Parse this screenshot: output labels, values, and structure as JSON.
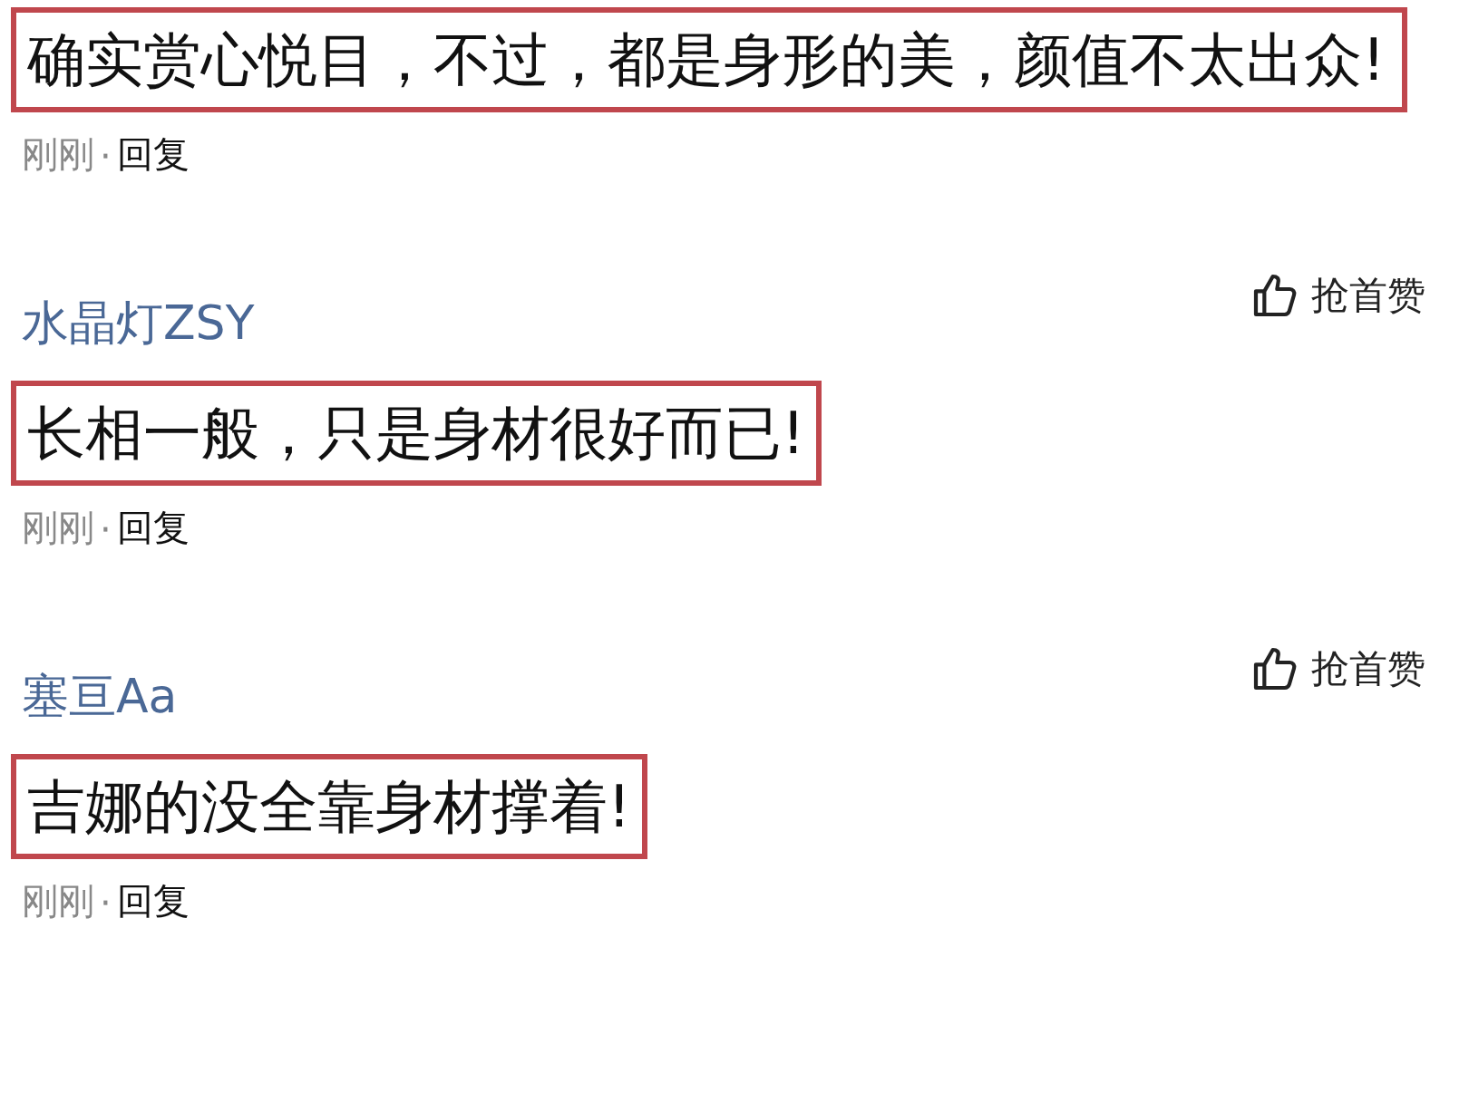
{
  "comments": [
    {
      "text": "确实赏心悦目，不过，都是身形的美，颜值不太出众!",
      "highlighted": true,
      "time": "刚刚",
      "separator": "·",
      "reply": "回复"
    },
    {
      "username": "水晶灯ZSY",
      "like": "抢首赞",
      "text": "长相一般，只是身材很好而已!",
      "highlighted": true,
      "time": "刚刚",
      "separator": "·",
      "reply": "回复"
    },
    {
      "username": "塞亘Aa",
      "like": "抢首赞",
      "text": "吉娜的没全靠身材撑着!",
      "highlighted": true,
      "time": "刚刚",
      "separator": "·",
      "reply": "回复"
    }
  ]
}
